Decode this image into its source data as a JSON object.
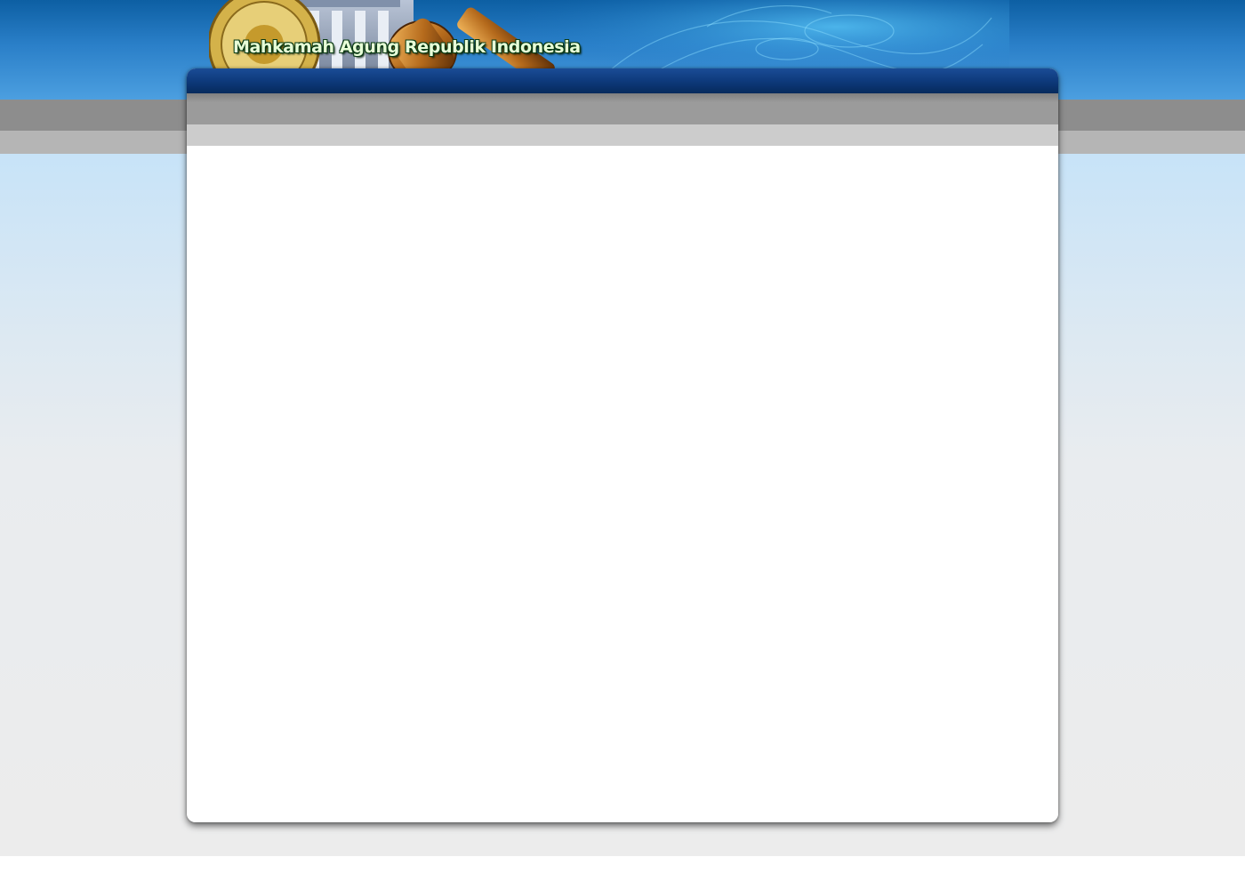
{
  "header": {
    "site_title": "Mahkamah Agung Republik Indonesia",
    "emblem_icon": "supreme-court-emblem-icon",
    "gavel_icon": "gavel-icon"
  },
  "nav": {
    "items": []
  },
  "content": {
    "text": ""
  },
  "colors": {
    "banner_blue": "#2a7fc8",
    "navbar_blue": "#0e3a7c",
    "title_green": "#e8ffd8"
  }
}
